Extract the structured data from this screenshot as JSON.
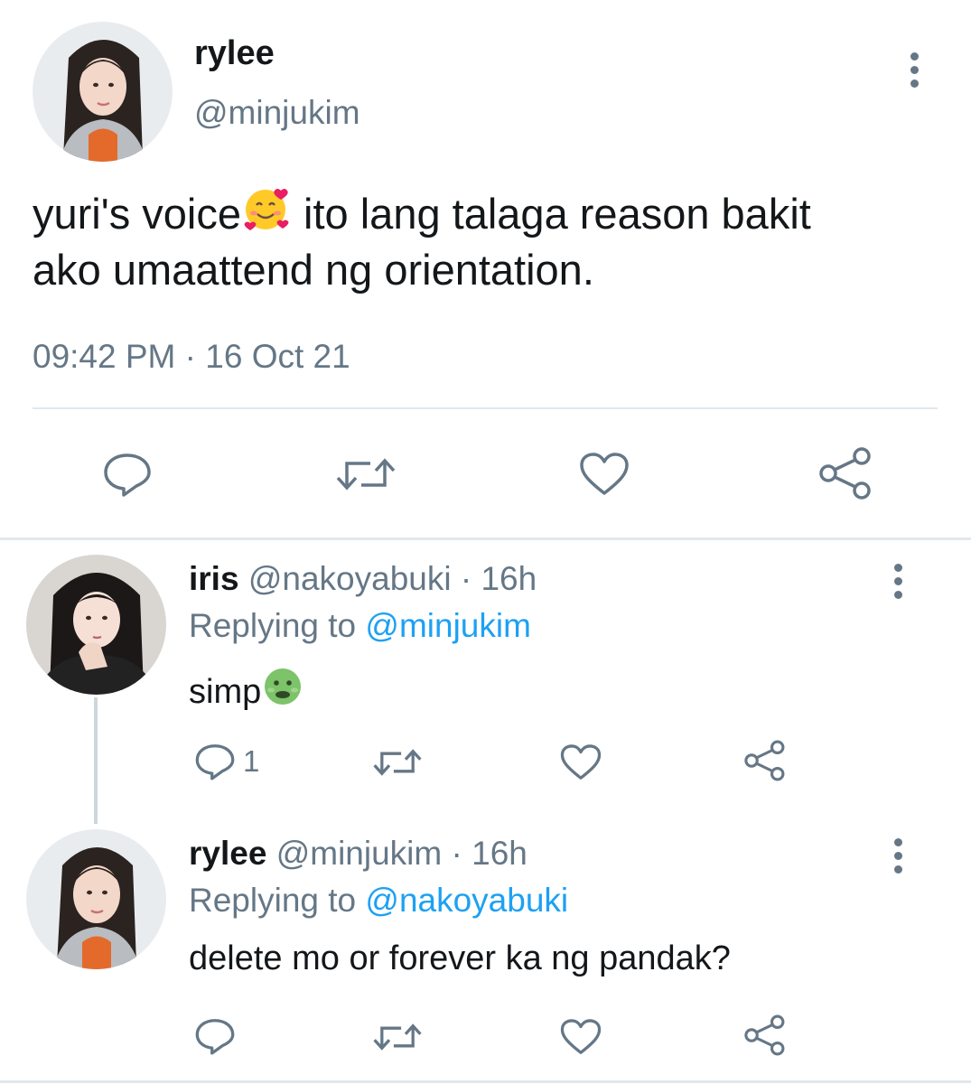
{
  "main_tweet": {
    "display_name": "rylee",
    "handle": "@minjukim",
    "text_line1": "yuri's voice",
    "emoji_1": "smiling-face-with-hearts",
    "text_line1b": " ito lang talaga reason bakit",
    "text_line2": "ako umaattend ng orientation.",
    "time": "09:42 PM",
    "separator": " · ",
    "date": "16 Oct 21"
  },
  "replies": [
    {
      "display_name": "iris",
      "handle": "@nakoyabuki",
      "age": " · 16h",
      "replying_prefix": "Replying to ",
      "replying_to": "@minjukim",
      "text": "simp",
      "emoji": "nauseated-face",
      "reply_count": "1"
    },
    {
      "display_name": "rylee",
      "handle": "@minjukim",
      "age": " · 16h",
      "replying_prefix": "Replying to ",
      "replying_to": "@nakoyabuki",
      "text": "delete mo or forever ka ng pandak?",
      "reply_count": ""
    }
  ],
  "colors": {
    "text": "#14171a",
    "muted": "#657786",
    "link": "#1da1f2",
    "divider": "#e1e8ed"
  }
}
